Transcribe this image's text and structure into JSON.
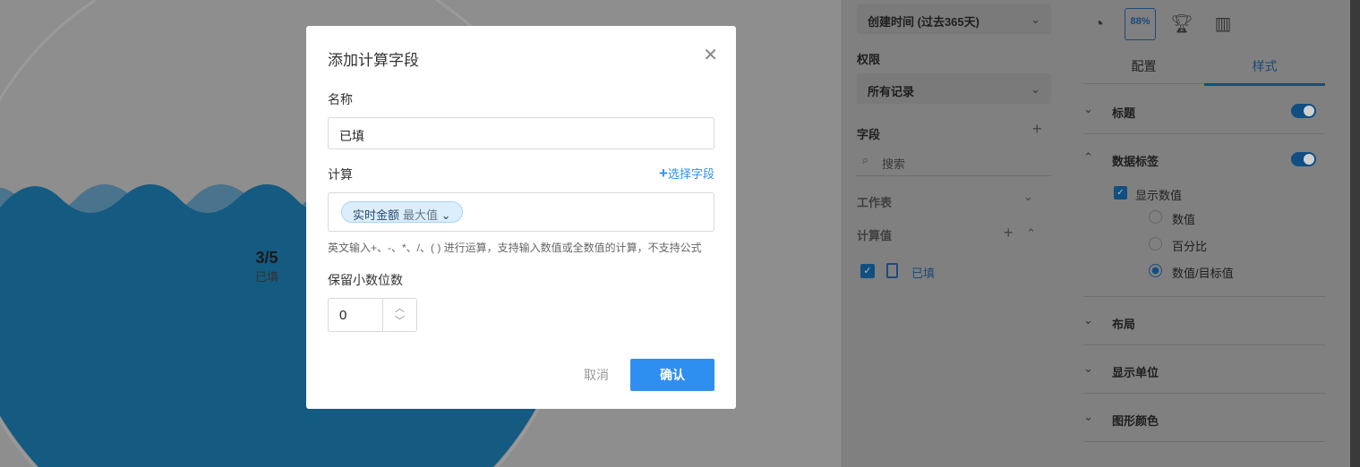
{
  "chart": {
    "value": "3/5",
    "label": "已填",
    "fill_fraction": 0.6,
    "fill_color": "#155a80"
  },
  "mid_panel": {
    "time_filter": "创建时间 (过去365天)",
    "permission_label": "权限",
    "permission_value": "所有记录",
    "fields_label": "字段",
    "search_placeholder": "搜索",
    "worksheet_label": "工作表",
    "calc_label": "计算值",
    "calc_items": [
      {
        "label": "已填",
        "checked": true
      }
    ]
  },
  "right_panel": {
    "chart_types": [
      "gauge-icon",
      "progress-icon",
      "trophy-icon",
      "map-icon"
    ],
    "progress_icon_text": "88%",
    "tabs": [
      {
        "label": "配置",
        "active": false
      },
      {
        "label": "样式",
        "active": true
      }
    ],
    "sections": {
      "title": {
        "label": "标题",
        "enabled": true
      },
      "data_label": {
        "label": "数据标签",
        "enabled": true,
        "show_value": "显示数值",
        "options": [
          "数值",
          "百分比",
          "数值/目标值"
        ],
        "selected": 2
      },
      "layout": "布局",
      "unit": "显示单位",
      "color": "图形颜色"
    }
  },
  "modal": {
    "title": "添加计算字段",
    "name_label": "名称",
    "name_value": "已填",
    "calc_label": "计算",
    "select_field": "选择字段",
    "chip_field": "实时金额",
    "chip_agg": "最大值",
    "hint": "英文输入+、-、*、/、( ) 进行运算，支持输入数值或全数值的计算，不支持公式",
    "decimals_label": "保留小数位数",
    "decimals_value": "0",
    "cancel": "取消",
    "confirm": "确认"
  },
  "colors": {
    "accent": "#2f8ff0",
    "dim_accent": "#114f82"
  }
}
